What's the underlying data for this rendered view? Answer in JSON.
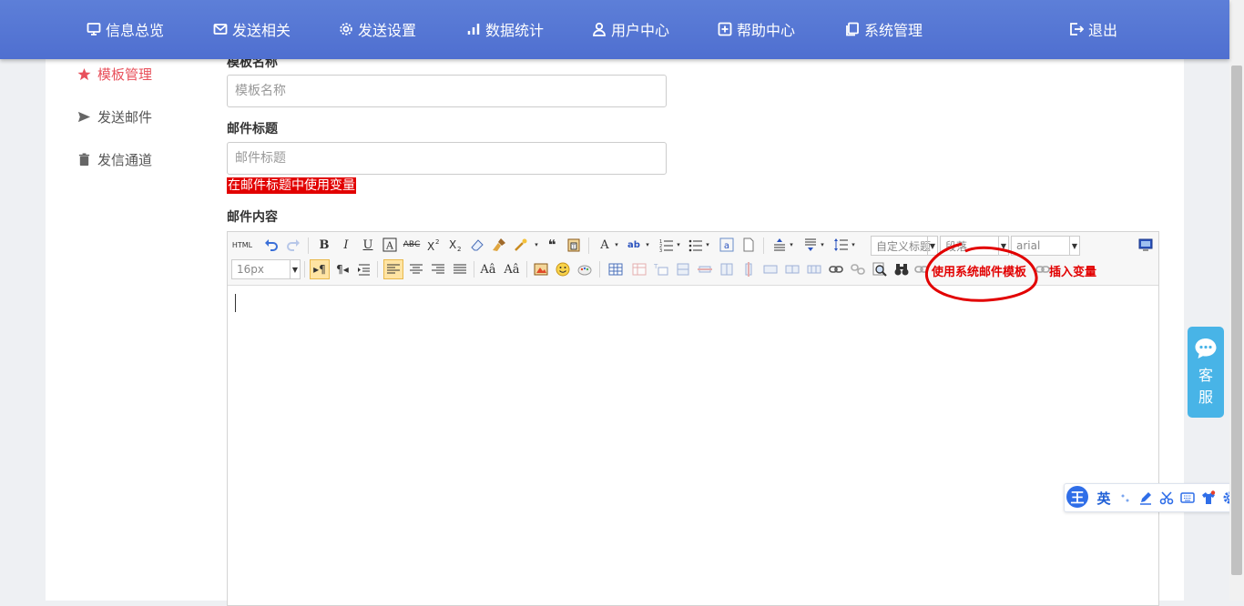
{
  "nav": {
    "items": [
      {
        "label": "信息总览",
        "icon": "monitor-icon"
      },
      {
        "label": "发送相关",
        "icon": "mail-icon"
      },
      {
        "label": "发送设置",
        "icon": "gear-icon"
      },
      {
        "label": "数据统计",
        "icon": "bar-chart-icon"
      },
      {
        "label": "用户中心",
        "icon": "user-icon"
      },
      {
        "label": "帮助中心",
        "icon": "help-box-icon"
      },
      {
        "label": "系统管理",
        "icon": "copy-icon"
      }
    ],
    "logout": {
      "label": "退出",
      "icon": "logout-icon"
    }
  },
  "sidebar": {
    "items": [
      {
        "label": "模板管理",
        "icon": "star-icon",
        "active": true
      },
      {
        "label": "发送邮件",
        "icon": "paper-plane-icon",
        "active": false
      },
      {
        "label": "发信通道",
        "icon": "trash-icon",
        "active": false
      }
    ]
  },
  "form": {
    "template_name": {
      "label": "模板名称",
      "placeholder": "模板名称",
      "value": ""
    },
    "mail_subject": {
      "label": "邮件标题",
      "placeholder": "邮件标题",
      "value": ""
    },
    "subject_variable_link": "在邮件标题中使用变量",
    "mail_content": {
      "label": "邮件内容"
    }
  },
  "editor": {
    "html_button": "HTML",
    "custom_title_combo": "自定义标题",
    "paragraph_combo": "段落",
    "font_family_combo": "arial",
    "font_size_combo": "16px",
    "use_template_link": "使用系统邮件模板",
    "insert_variable_link": "插入变量",
    "colors": {
      "link": "#e20000",
      "highlight": "#ffe4a3"
    }
  },
  "support_widget": {
    "line1": "客",
    "line2": "服",
    "color": "#48b4e7"
  },
  "ime_bar": {
    "logo": "王",
    "mode": "英"
  },
  "theme": {
    "topbar": "#5474d4",
    "active": "#e8505b",
    "annotation": "#e20000"
  }
}
